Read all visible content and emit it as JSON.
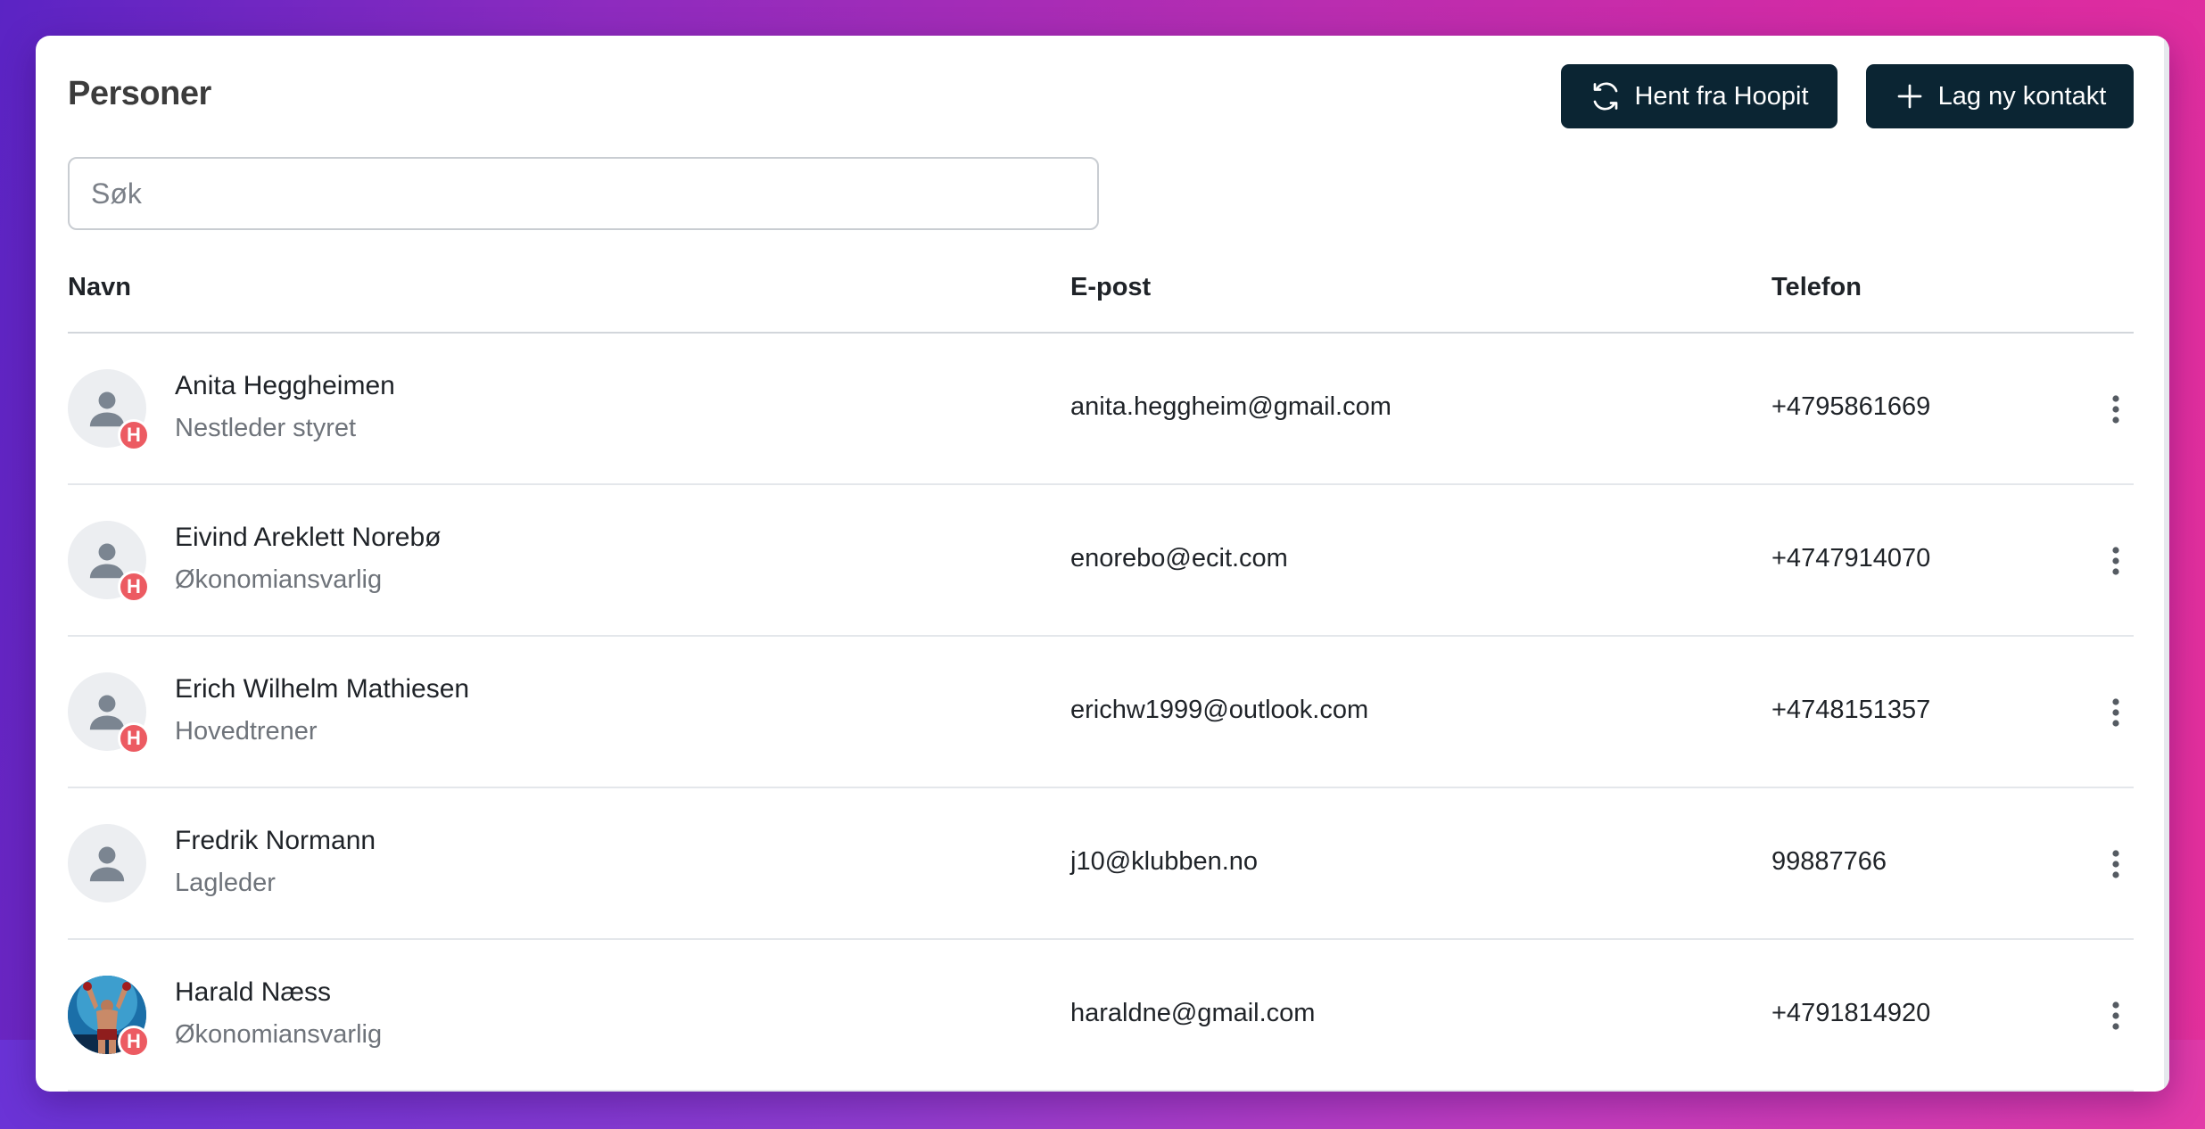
{
  "page": {
    "title": "Personer"
  },
  "toolbar": {
    "sync_label": "Hent fra Hoopit",
    "sync_icon": "refresh-icon",
    "new_label": "Lag ny kontakt",
    "new_icon": "plus-icon"
  },
  "search": {
    "placeholder": "Søk",
    "value": ""
  },
  "table": {
    "headers": {
      "name": "Navn",
      "email": "E-post",
      "phone": "Telefon"
    },
    "rows": [
      {
        "name": "Anita Heggheimen",
        "role": "Nestleder styret",
        "email": "anita.heggheim@gmail.com",
        "phone": "+4795861669",
        "badge": "H",
        "avatar": "person-icon"
      },
      {
        "name": "Eivind Areklett Norebø",
        "role": "Økonomiansvarlig",
        "email": "enorebo@ecit.com",
        "phone": "+4747914070",
        "badge": "H",
        "avatar": "person-icon"
      },
      {
        "name": "Erich Wilhelm Mathiesen",
        "role": "Hovedtrener",
        "email": "erichw1999@outlook.com",
        "phone": "+4748151357",
        "badge": "H",
        "avatar": "person-icon"
      },
      {
        "name": "Fredrik Normann",
        "role": "Lagleder",
        "email": "j10@klubben.no",
        "phone": "99887766",
        "badge": "",
        "avatar": "person-icon"
      },
      {
        "name": "Harald Næss",
        "role": "Økonomiansvarlig",
        "email": "haraldne@gmail.com",
        "phone": "+4791814920",
        "badge": "H",
        "avatar": "photo"
      }
    ]
  },
  "colors": {
    "button_bg": "#0b2533",
    "badge_bg": "#ec5b62",
    "avatar_icon": "#7b8591",
    "avatar_bg": "#eceef1"
  }
}
